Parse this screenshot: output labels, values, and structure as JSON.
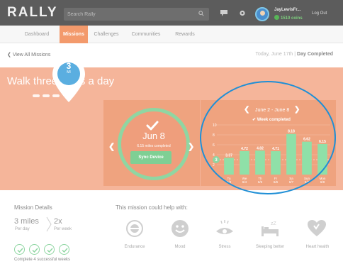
{
  "app": {
    "logo": "RALLY",
    "search_placeholder": "Search Rally",
    "user_name": "JayLewisFr...",
    "coins": "1510 coins",
    "logout": "Log Out"
  },
  "nav": {
    "tabs": [
      {
        "label": "Dashboard",
        "active": false
      },
      {
        "label": "Missions",
        "active": true
      },
      {
        "label": "Challenges",
        "active": false
      },
      {
        "label": "Communities",
        "active": false
      },
      {
        "label": "Rewards",
        "active": false
      }
    ]
  },
  "subheader": {
    "back_link": "View All Missions",
    "date_prefix": "Today, June 17th | ",
    "day_status": "Day Completed"
  },
  "mission": {
    "title": "Walk three miles a day",
    "badge_number": "3",
    "badge_unit": "MI",
    "day_date": "Jun 8",
    "day_miles": "6.15 miles completed",
    "sync_label": "Sync Device",
    "week_range": "June 2 - June 8",
    "week_status": "Week completed"
  },
  "chart_data": {
    "type": "bar",
    "categories": [
      "Tu 6/3",
      "We 6/4",
      "Th 6/5",
      "Fr 6/6",
      "Sa 6/7",
      "Sun 6/7",
      "Mon 6/8"
    ],
    "values": [
      3.37,
      4.72,
      4.82,
      4.71,
      8.18,
      6.62,
      6.15
    ],
    "value_labels": [
      "3.37",
      "4.72",
      "4.82",
      "4.71",
      "8.18",
      "6.62",
      "6.15"
    ],
    "ylim": [
      0,
      10
    ],
    "yticks": [
      "10",
      "8",
      "6",
      "4",
      "2"
    ],
    "goal_marker": "3",
    "grid": true,
    "bar_color": "#8fe0a8"
  },
  "mission_details": {
    "title": "Mission Details",
    "miles_value": "3 miles",
    "miles_unit": "Per day",
    "times_value": "2x",
    "times_unit": "Per week",
    "weeks_total": 4,
    "complete_text": "Complete 4 successful weeks"
  },
  "help": {
    "title": "This mission could help with:",
    "items": [
      {
        "label": "Endurance",
        "icon": "endurance-icon"
      },
      {
        "label": "Mood",
        "icon": "mood-icon"
      },
      {
        "label": "Stress",
        "icon": "stress-icon"
      },
      {
        "label": "Sleeping better",
        "icon": "sleep-icon"
      },
      {
        "label": "Heart health",
        "icon": "heart-icon"
      }
    ]
  },
  "colors": {
    "accent": "#f39a6c",
    "hero": "#f5b59a",
    "success": "#8fd6a2",
    "highlight_ring": "#1f8fd6"
  }
}
